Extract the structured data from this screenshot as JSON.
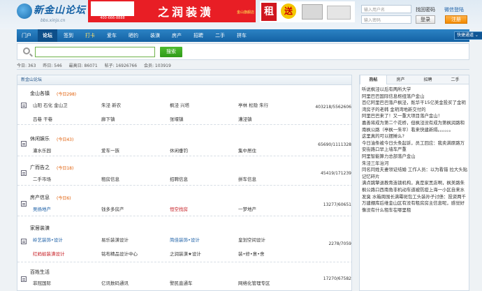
{
  "header": {
    "logo_text": "新金山论坛",
    "logo_url": "bbs.xinjs.cn",
    "banner_title": "之润装潢",
    "banner_phone": "400-666-8888",
    "banner_tag": "金山旗舰店",
    "ad_zu": "租",
    "ad_logo": "送",
    "login_user_placeholder": "输入用户名",
    "login_pass_placeholder": "输入密码",
    "forgot_label": "找回密码",
    "wechat_label": "微信登陆",
    "login_label": "登录",
    "register_label": "注册"
  },
  "nav": {
    "items": [
      "门户",
      "论坛",
      "签到",
      "打卡",
      "爱车",
      "晒钓",
      "装潢",
      "房产",
      "招聘",
      "二手",
      "拼车"
    ],
    "active_index": 1,
    "special_index": 3,
    "quick_label": "快捷通道 ⌄"
  },
  "search": {
    "placeholder": "",
    "button_label": "搜索"
  },
  "stats": {
    "today": "今日: 363",
    "yesterday": "昨日: 546",
    "max": "最高日: 86071",
    "posts": "帖子: 16926766",
    "members": "会员: 103919"
  },
  "forum": {
    "header_label": "新金山论坛",
    "boards": [
      {
        "title": "金山各镇",
        "today": "(今日298)",
        "subs": [
          "山阳 石化 金山卫",
          "朱泾 新农",
          "枫泾 兴塔",
          "亭林 松隐 朱行",
          "吕巷 干巷",
          "廊下镇",
          "张堰镇",
          "漕泾镇"
        ],
        "count": "403218/5562606"
      },
      {
        "title": "休闲娱乐",
        "today": "(今日43)",
        "subs": [
          "灌水乐园",
          "爱车一族",
          "休闲垂钓",
          "集中居住"
        ],
        "count": "65690/1111328"
      },
      {
        "title": "广而告之",
        "today": "(今日18)",
        "subs": [
          "二手市场",
          "租房信息",
          "招聘信息",
          "拼车信息"
        ],
        "count": "45419/171239"
      },
      {
        "title": "房产信息",
        "today": "(今日6)",
        "subs": [
          "吴扬地产",
          "钱多多房产",
          "恒空找房",
          "一梦地产"
        ],
        "count": "13277/60651"
      },
      {
        "title": "家居装潢",
        "today": "",
        "subs": [
          "岭艺装饰•设计",
          "易乐装潢设计",
          "简佳装饰•设计",
          "皇划空间设计",
          "红蚂蚁装潢设计",
          "铭布精品设计中心",
          "之润装潢★设计",
          "装•修•意•舍"
        ],
        "count": "2278/7059"
      },
      {
        "title": "百姓生活",
        "today": "",
        "subs": [
          "菲冠国际",
          "亿讯数码通讯",
          "警民直通车",
          "网络化管理专区"
        ],
        "count": "17270/67582"
      }
    ]
  },
  "side": {
    "tabs": [
      "热帖",
      "房产",
      "招聘",
      "二手"
    ],
    "active_tab": 0,
    "items": [
      "听说枫泾以后有两所大学",
      "阿里巴巴国际信息枢纽落户金山",
      "百亿阿里巴巴落户枫泾，既华干15亿美金投买了金玥湾房子的老韩 金玥湾地新交付的",
      "阿里巴巴来了！又一重大项目落户金山！",
      "嘉善将成为第二个花桥，但枫泾没有成为第枫润路和南枫公路（亭枫一朱平）看来快建新隔。。。。。。",
      "这里真的可以摆摊么?",
      "今日油条被今日头条起诉，员工回应：我卖满原路万安街路口早上墙车严重",
      "阿里智能算力总部落户金山",
      "朱泾三年治河",
      "同名同姓夫妻领证结婚 工作人员：以为看错 拉大头贴",
      "记忆碎片",
      "满点跳擎退教育连锁机构，真是家黑店啊，枫美路朱枫公路口西南角非机动车道被防疫上海一小区自来水发臭 水箱周围长满霉斑包工头装孙子讨债：投资两千万建棚库后维金山区有没有租房房主信息呢，感觉好像没有什么租车在哪里租"
    ]
  }
}
